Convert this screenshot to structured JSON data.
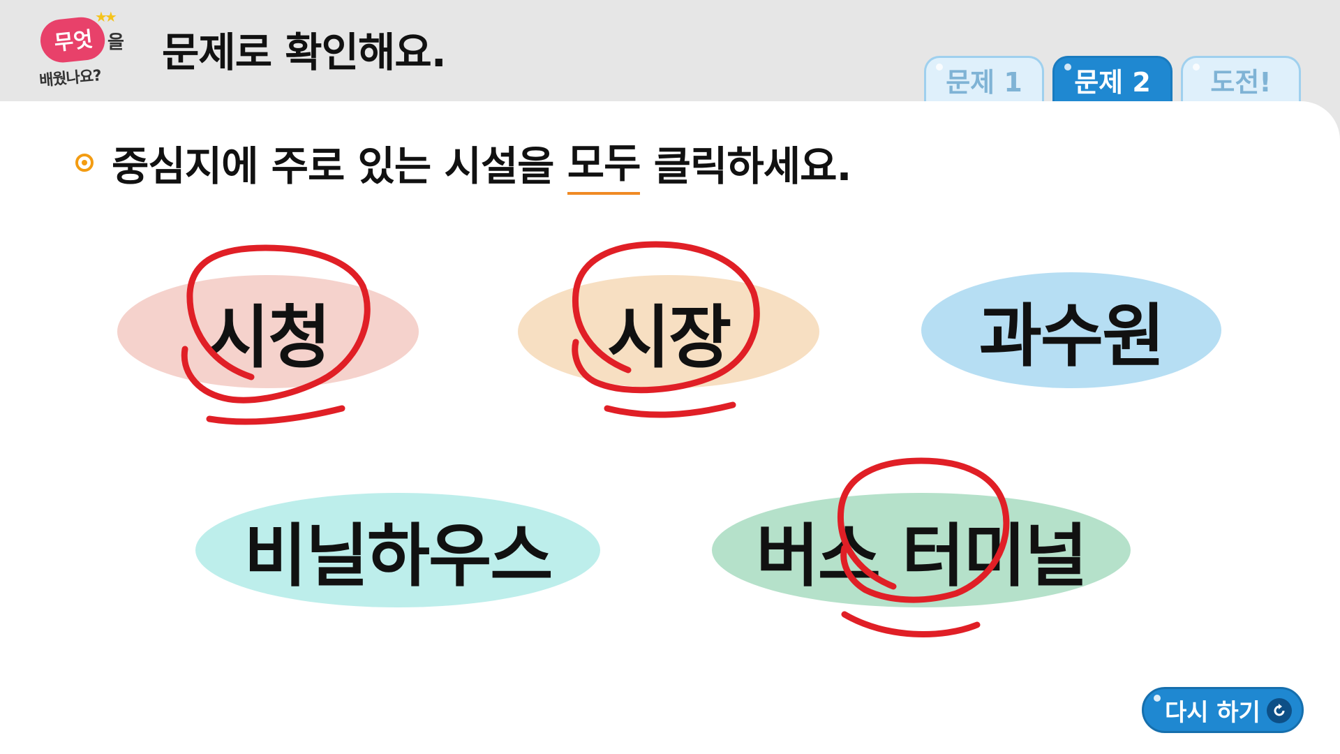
{
  "header": {
    "logo": {
      "badge": "무엇",
      "eul": "을",
      "sub": "배웠나요?",
      "stars": "★★"
    },
    "title": "문제로 확인해요.",
    "tabs": [
      {
        "label": "문제 1",
        "active": false
      },
      {
        "label": "문제 2",
        "active": true
      },
      {
        "label": "도전!",
        "active": false
      }
    ]
  },
  "instruction": {
    "before": "중심지에 주로 있는 시설을 ",
    "emphasis": "모두",
    "after": " 클릭하세요."
  },
  "options": [
    {
      "label": "시청",
      "color": "#f5d2cc",
      "selected": true
    },
    {
      "label": "시장",
      "color": "#f7dfc2",
      "selected": true
    },
    {
      "label": "과수원",
      "color": "#b6def3",
      "selected": false
    },
    {
      "label": "비닐하우스",
      "color": "#bdeeeb",
      "selected": false
    },
    {
      "label": "버스 터미널",
      "color": "#b5e1ca",
      "selected": true
    }
  ],
  "retry_button": {
    "label": "다시 하기",
    "icon": "refresh-icon"
  },
  "colors": {
    "accent": "#1f88d1",
    "mark": "#e01f26",
    "bullet": "#f39c12",
    "underline": "#f08a24"
  }
}
